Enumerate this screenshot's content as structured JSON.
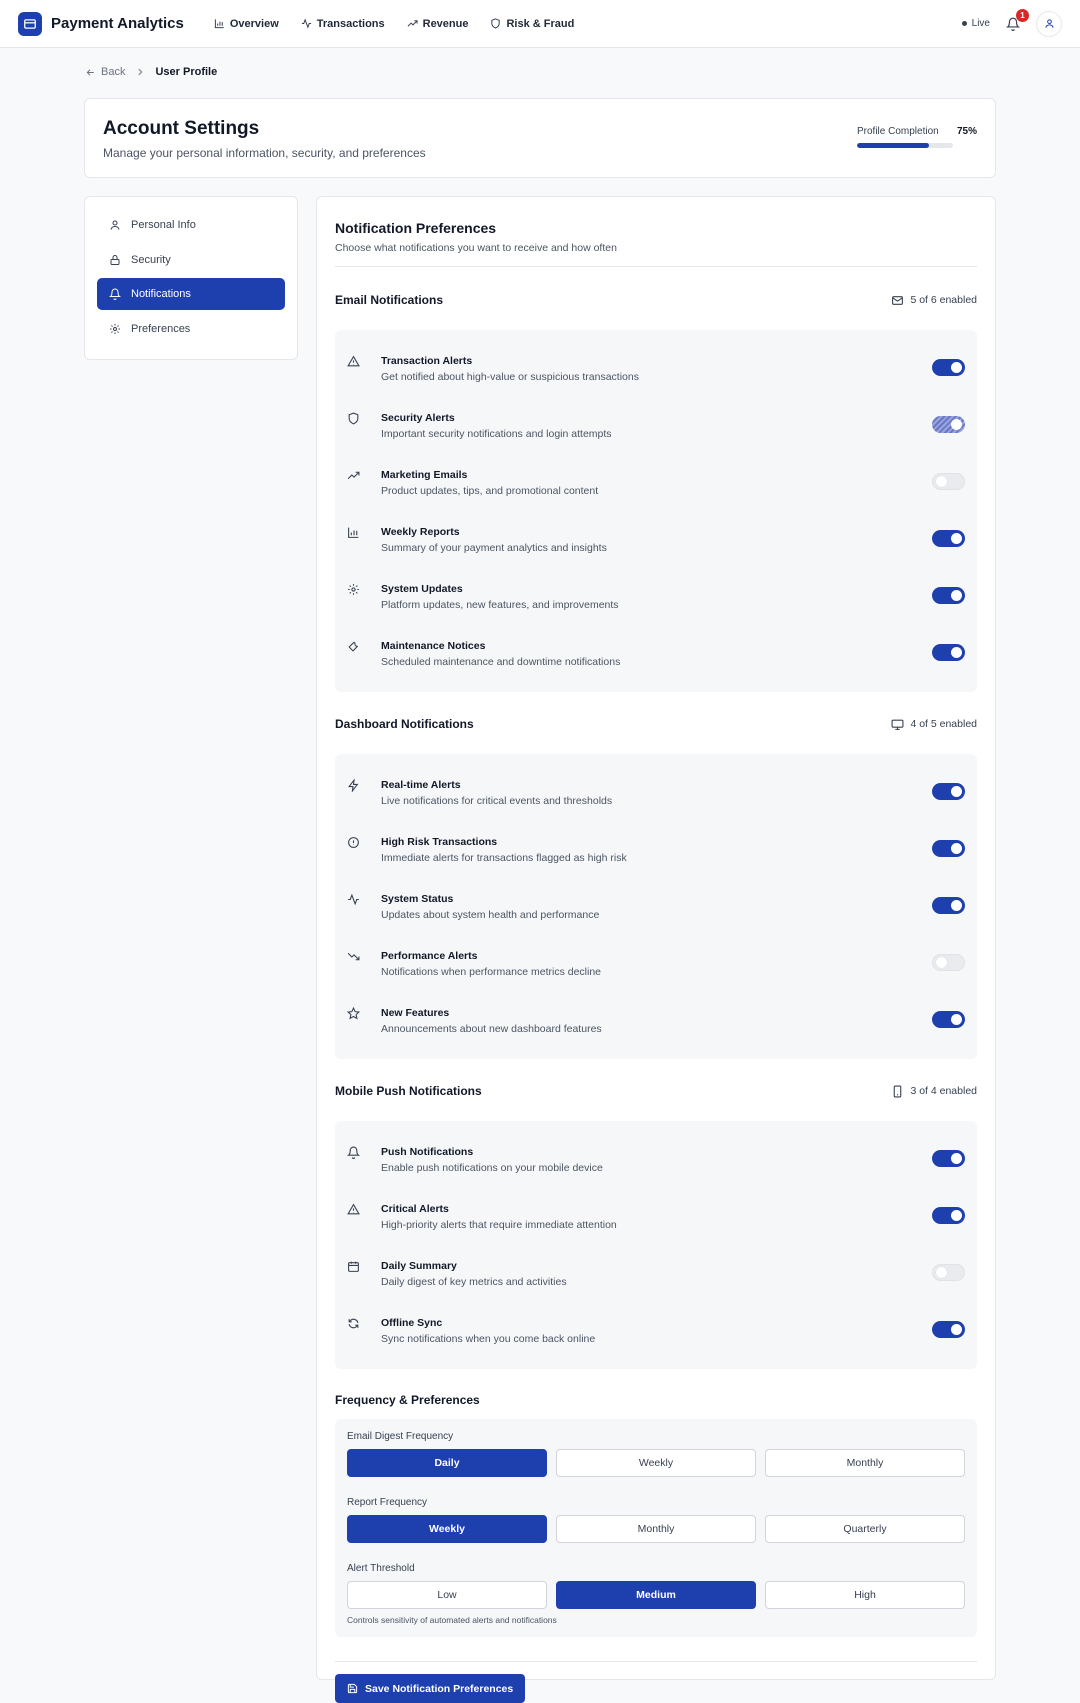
{
  "nav": {
    "brand": "Payment Analytics",
    "links": [
      {
        "label": "Overview",
        "icon": "bar-chart-icon"
      },
      {
        "label": "Transactions",
        "icon": "activity-icon"
      },
      {
        "label": "Revenue",
        "icon": "trending-up-icon"
      },
      {
        "label": "Risk & Fraud",
        "icon": "shield-icon"
      }
    ],
    "live_label": "Live",
    "notification_count": "1"
  },
  "breadcrumb": {
    "back": "Back",
    "current": "User Profile"
  },
  "header": {
    "title": "Account Settings",
    "subtitle": "Manage your personal information, security, and preferences",
    "completion_label": "Profile Completion",
    "completion_value": "75%",
    "completion_fraction": 0.75
  },
  "sidebar": {
    "items": [
      {
        "label": "Personal Info",
        "icon": "user-icon",
        "active": false
      },
      {
        "label": "Security",
        "icon": "lock-icon",
        "active": false
      },
      {
        "label": "Notifications",
        "icon": "bell-icon",
        "active": true
      },
      {
        "label": "Preferences",
        "icon": "gear-icon",
        "active": false
      }
    ]
  },
  "main": {
    "title": "Notification Preferences",
    "subtitle": "Choose what notifications you want to receive and how often"
  },
  "email": {
    "title": "Email Notifications",
    "count": "5 of 6 enabled",
    "icon": "mail-icon",
    "items": [
      {
        "title": "Transaction Alerts",
        "desc": "Get notified about high-value or suspicious transactions",
        "icon": "alert-triangle-icon",
        "state": "on"
      },
      {
        "title": "Security Alerts",
        "desc": "Important security notifications and login attempts",
        "icon": "shield-icon",
        "state": "hatch"
      },
      {
        "title": "Marketing Emails",
        "desc": "Product updates, tips, and promotional content",
        "icon": "trending-up-icon",
        "state": "off"
      },
      {
        "title": "Weekly Reports",
        "desc": "Summary of your payment analytics and insights",
        "icon": "bar-chart-icon",
        "state": "on"
      },
      {
        "title": "System Updates",
        "desc": "Platform updates, new features, and improvements",
        "icon": "gear-icon",
        "state": "on"
      },
      {
        "title": "Maintenance Notices",
        "desc": "Scheduled maintenance and downtime notifications",
        "icon": "wrench-icon",
        "state": "on"
      }
    ]
  },
  "dashboard": {
    "title": "Dashboard Notifications",
    "count": "4 of 5 enabled",
    "icon": "monitor-icon",
    "items": [
      {
        "title": "Real-time Alerts",
        "desc": "Live notifications for critical events and thresholds",
        "icon": "zap-icon",
        "state": "on"
      },
      {
        "title": "High Risk Transactions",
        "desc": "Immediate alerts for transactions flagged as high risk",
        "icon": "alert-circle-icon",
        "state": "on"
      },
      {
        "title": "System Status",
        "desc": "Updates about system health and performance",
        "icon": "activity-icon",
        "state": "on"
      },
      {
        "title": "Performance Alerts",
        "desc": "Notifications when performance metrics decline",
        "icon": "trending-down-icon",
        "state": "off"
      },
      {
        "title": "New Features",
        "desc": "Announcements about new dashboard features",
        "icon": "star-icon",
        "state": "on"
      }
    ]
  },
  "mobile": {
    "title": "Mobile Push Notifications",
    "count": "3 of 4 enabled",
    "icon": "smartphone-icon",
    "items": [
      {
        "title": "Push Notifications",
        "desc": "Enable push notifications on your mobile device",
        "icon": "bell-icon",
        "state": "on"
      },
      {
        "title": "Critical Alerts",
        "desc": "High-priority alerts that require immediate attention",
        "icon": "alert-triangle-icon",
        "state": "on"
      },
      {
        "title": "Daily Summary",
        "desc": "Daily digest of key metrics and activities",
        "icon": "calendar-icon",
        "state": "off"
      },
      {
        "title": "Offline Sync",
        "desc": "Sync notifications when you come back online",
        "icon": "refresh-icon",
        "state": "on"
      }
    ]
  },
  "frequency": {
    "title": "Frequency & Preferences",
    "email_digest": {
      "label": "Email Digest Frequency",
      "options": [
        "Daily",
        "Weekly",
        "Monthly"
      ],
      "selected": "Daily"
    },
    "report": {
      "label": "Report Frequency",
      "options": [
        "Weekly",
        "Monthly",
        "Quarterly"
      ],
      "selected": "Weekly"
    },
    "alert": {
      "label": "Alert Threshold",
      "options": [
        "Low",
        "Medium",
        "High"
      ],
      "selected": "Medium",
      "hint": "Controls sensitivity of automated alerts and notifications"
    }
  },
  "save_label": "Save Notification Preferences",
  "colors": {
    "accent": "#1e40af",
    "badge": "#dc2626"
  }
}
